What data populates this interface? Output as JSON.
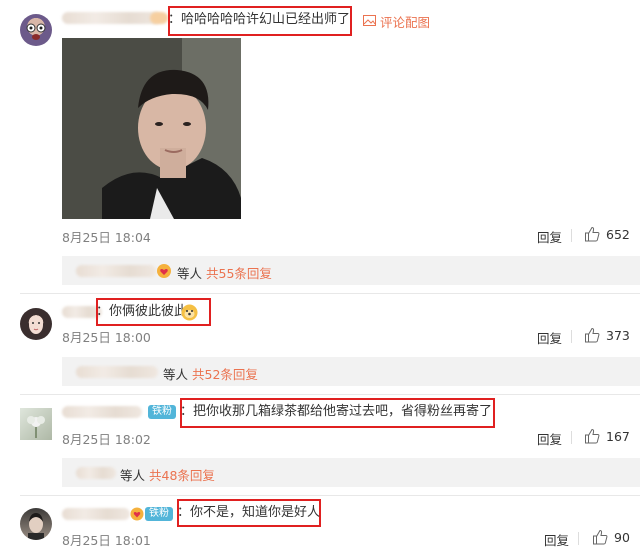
{
  "comments": [
    {
      "text": "：哈哈哈哈哈许幻山已经出师了",
      "with_image_label": "评论配图",
      "time": "8月25日 18:04",
      "reply_label": "回复",
      "likes": "652",
      "sub": {
        "who": "等人",
        "link": "共55条回复"
      }
    },
    {
      "text": "：你俩彼此彼此",
      "time": "8月25日 18:00",
      "reply_label": "回复",
      "likes": "373",
      "sub": {
        "who": "等人",
        "link": "共52条回复"
      }
    },
    {
      "badge": "铁粉",
      "text": "：把你收那几箱绿茶都给他寄过去吧，省得粉丝再寄了",
      "time": "8月25日 18:02",
      "reply_label": "回复",
      "likes": "167",
      "sub": {
        "who": "等人",
        "link": "共48条回复"
      }
    },
    {
      "badge": "铁粉",
      "text": "：你不是，知道你是好人",
      "time": "8月25日 18:01",
      "reply_label": "回复",
      "likes": "90"
    }
  ],
  "colors": {
    "highlight_box": "#e02020",
    "link": "#eb7350",
    "badge": "#52b5d9"
  },
  "icons": [
    "image-icon",
    "thumb-up-icon",
    "heart-emoji-icon",
    "dog-emoji-icon"
  ]
}
